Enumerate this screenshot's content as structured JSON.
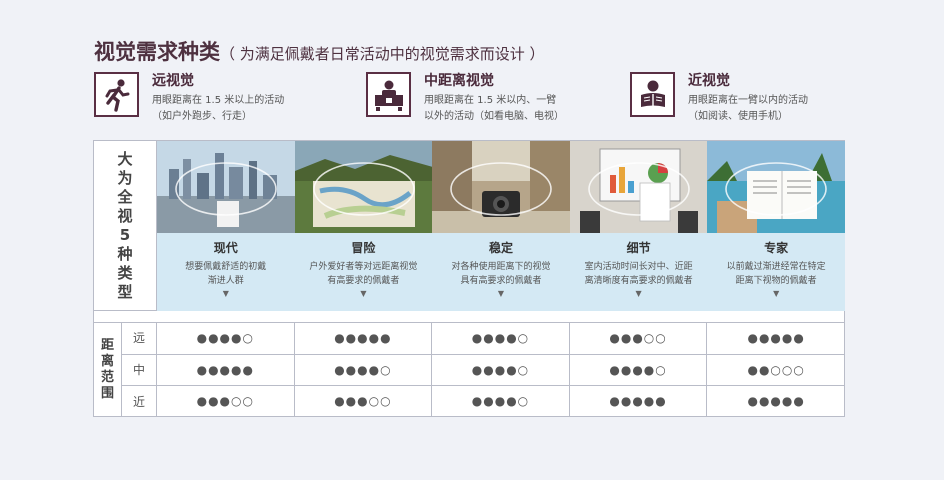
{
  "title": {
    "main": "视觉需求种类",
    "sub": "（ 为满足佩戴者日常活动中的视觉需求而设计 ）"
  },
  "vision_types": [
    {
      "icon": "running-person-icon",
      "name": "远视觉",
      "desc_line1": "用眼距离在 1.5 米以上的活动",
      "desc_line2": "（如户外跑步、行走）"
    },
    {
      "icon": "computer-user-icon",
      "name": "中距离视觉",
      "desc_line1": "用眼距离在 1.5 米以内、一臂",
      "desc_line2": "以外的活动（如看电脑、电视）"
    },
    {
      "icon": "reading-person-icon",
      "name": "近视觉",
      "desc_line1": "用眼距离在一臂以内的活动",
      "desc_line2": "（如阅读、使用手机）"
    }
  ],
  "types_header": [
    "大",
    "为",
    "全",
    "视",
    "5",
    "种",
    "类",
    "型"
  ],
  "types": [
    {
      "name": "现代",
      "desc_line1": "想要佩戴舒适的初戴",
      "desc_line2": "渐进人群"
    },
    {
      "name": "冒险",
      "desc_line1": "户外爱好者等对远距离视觉",
      "desc_line2": "有高要求的佩戴者"
    },
    {
      "name": "稳定",
      "desc_line1": "对各种使用距离下的视觉",
      "desc_line2": "具有高要求的佩戴者"
    },
    {
      "name": "细节",
      "desc_line1": "室内活动时间长对中、近距",
      "desc_line2": "离清晰度有高要求的佩戴者"
    },
    {
      "name": "专家",
      "desc_line1": "以前戴过渐进经常在特定",
      "desc_line2": "距离下视物的佩戴者"
    }
  ],
  "distance_header": [
    "距",
    "离",
    "范",
    "围"
  ],
  "distance_rows": [
    {
      "label": "远",
      "ratings": [
        "●●●●○",
        "●●●●●",
        "●●●●○",
        "●●●○○",
        "●●●●●"
      ]
    },
    {
      "label": "中",
      "ratings": [
        "●●●●●",
        "●●●●○",
        "●●●●○",
        "●●●●○",
        "●●○○○"
      ]
    },
    {
      "label": "近",
      "ratings": [
        "●●●○○",
        "●●●○○",
        "●●●●○",
        "●●●●●",
        "●●●●●"
      ]
    }
  ]
}
